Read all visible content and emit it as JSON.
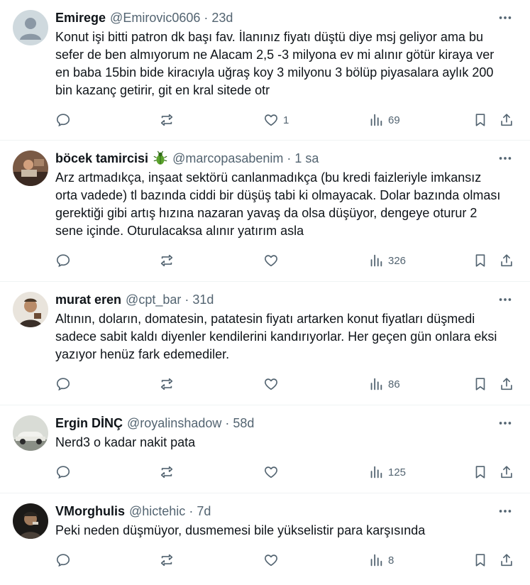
{
  "colors": {
    "text": "#0f1419",
    "secondary": "#536471",
    "divider": "#eff3f4"
  },
  "tweets": [
    {
      "name": "Emirege",
      "handle": "@Emirovic0606",
      "sep": "·",
      "time": "23d",
      "avatar": "default-avatar",
      "text": "Konut işi bitti patron dk başı fav. İlanınız fiyatı düştü diye msj geliyor ama bu sefer de ben almıyorum ne Alacam 2,5 -3 milyona ev mi alınır götür kiraya ver en baba 15bin bide kiracıyla uğraş koy 3 milyonu 3 bölüp piyasalara aylık 200 bin kazanç getirir, git en kral sitede otr",
      "likes": "1",
      "views": "69"
    },
    {
      "name": "böcek tamircisi",
      "emoji": "beetle-emoji",
      "handle": "@marcopasabenim",
      "sep": "·",
      "time": "1 sa",
      "avatar": "photo-avatar",
      "text": "Arz artmadıkça, inşaat sektörü canlanmadıkça (bu kredi faizleriyle imkansız orta vadede) tl bazında ciddi bir düşüş tabi ki olmayacak. Dolar bazında olması gerektiği gibi artış hızına nazaran yavaş da olsa düşüyor, dengeye oturur 2 sene içinde. Oturulacaksa alınır yatırım asla",
      "likes": "",
      "views": "326"
    },
    {
      "name": "murat eren",
      "handle": "@cpt_bar",
      "sep": "·",
      "time": "31d",
      "avatar": "photo-avatar",
      "text": "Altının, doların, domatesin, patatesin fiyatı artarken konut fiyatları düşmedi sadece sabit kaldı diyenler kendilerini kandırıyorlar. Her geçen gün onlara eksi yazıyor henüz fark edemediler.",
      "likes": "",
      "views": "86"
    },
    {
      "name": "Ergin DİNÇ",
      "handle": "@royalinshadow",
      "sep": "·",
      "time": "58d",
      "avatar": "car-photo-avatar",
      "text": "Nerd3 o kadar nakit pata",
      "likes": "",
      "views": "125"
    },
    {
      "name": "VMorghulis",
      "handle": "@hictehic",
      "sep": "·",
      "time": "7d",
      "avatar": "photo-avatar",
      "text": "Peki neden düşmüyor, dusmemesi bile yükselistir para karşısında",
      "likes": "",
      "views": "8"
    }
  ]
}
